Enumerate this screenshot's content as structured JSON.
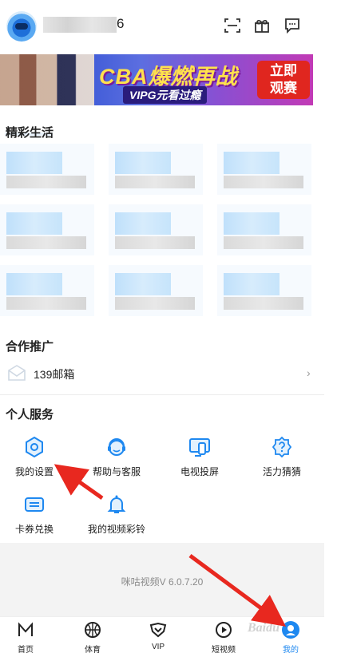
{
  "header": {
    "username_suffix": "6",
    "icons": [
      "scan-icon",
      "gift-icon",
      "message-icon"
    ]
  },
  "banner": {
    "title": "CBA爆燃再战",
    "subtitle": "VIPG元看过瘾",
    "cta": "立即观赛"
  },
  "sections": {
    "featured_title": "精彩生活",
    "partner_title": "合作推广",
    "personal_title": "个人服务"
  },
  "partner": {
    "items": [
      {
        "label": "139邮箱",
        "icon": "mailbox-icon"
      }
    ]
  },
  "services": [
    {
      "label": "我的设置",
      "icon": "settings-hexagon-icon"
    },
    {
      "label": "帮助与客服",
      "icon": "headset-icon"
    },
    {
      "label": "电视投屏",
      "icon": "tv-cast-icon"
    },
    {
      "label": "活力猜猜",
      "icon": "quiz-badge-icon"
    },
    {
      "label": "卡券兑换",
      "icon": "coupon-icon"
    },
    {
      "label": "我的视频彩铃",
      "icon": "ringtone-bell-icon"
    }
  ],
  "version": "咪咕视频V 6.0.7.20",
  "bottom_nav": [
    {
      "label": "首页",
      "icon": "home-logo-icon"
    },
    {
      "label": "体育",
      "icon": "basketball-icon"
    },
    {
      "label": "VIP",
      "icon": "vip-heart-icon"
    },
    {
      "label": "短视频",
      "icon": "play-circle-icon"
    },
    {
      "label": "我的",
      "icon": "profile-icon",
      "active": true
    }
  ],
  "watermark": "Baidu",
  "colors": {
    "accent": "#1e88f0",
    "arrow": "#e8281f",
    "banner_cta": "#e0261f"
  }
}
